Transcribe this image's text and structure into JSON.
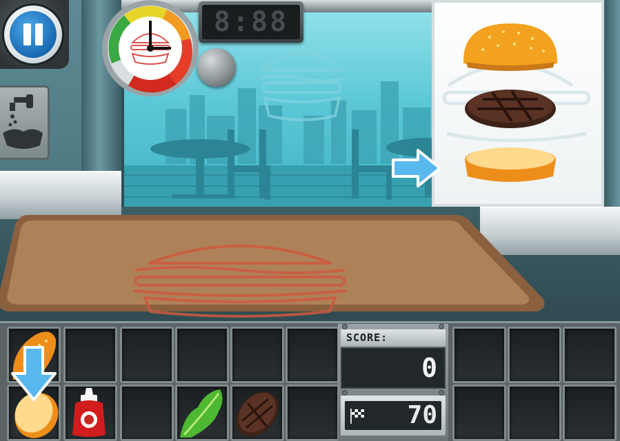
{
  "hud": {
    "timer_display": "8:88",
    "score_label": "SCORE:",
    "score_value": "0",
    "goal_value": "70"
  },
  "controls": {
    "pause_icon": "pause-icon",
    "timer_gauge_icon": "burger-gauge-icon",
    "bell_icon": "bell-icon",
    "wash_hands_icon": "wash-hands-icon",
    "goal_icon": "checkered-flag-icon"
  },
  "order": {
    "layers": [
      "top-bun",
      "beef-patty",
      "bottom-bun"
    ]
  },
  "ingredients": [
    {
      "slot": 0,
      "icon": "top-bun-icon"
    },
    {
      "slot": 1,
      "icon": "empty"
    },
    {
      "slot": 2,
      "icon": "empty"
    },
    {
      "slot": 3,
      "icon": "empty"
    },
    {
      "slot": 4,
      "icon": "empty"
    },
    {
      "slot": 5,
      "icon": "empty"
    },
    {
      "slot": 6,
      "icon": "empty"
    },
    {
      "slot": 7,
      "icon": "empty"
    },
    {
      "slot": 8,
      "icon": "empty"
    },
    {
      "slot": 9,
      "icon": "bottom-bun-icon"
    },
    {
      "slot": 10,
      "icon": "ketchup-icon"
    },
    {
      "slot": 11,
      "icon": "empty"
    },
    {
      "slot": 12,
      "icon": "lettuce-icon"
    },
    {
      "slot": 13,
      "icon": "beef-patty-icon"
    },
    {
      "slot": 14,
      "icon": "empty"
    },
    {
      "slot": 15,
      "icon": "empty"
    },
    {
      "slot": 16,
      "icon": "empty"
    },
    {
      "slot": 17,
      "icon": "empty"
    }
  ],
  "colors": {
    "pause_blue": "#1869b3",
    "tray_brown": "#a77a55",
    "window_cyan": "#5cc8d6",
    "hint_arrow": "#59b8ee"
  }
}
